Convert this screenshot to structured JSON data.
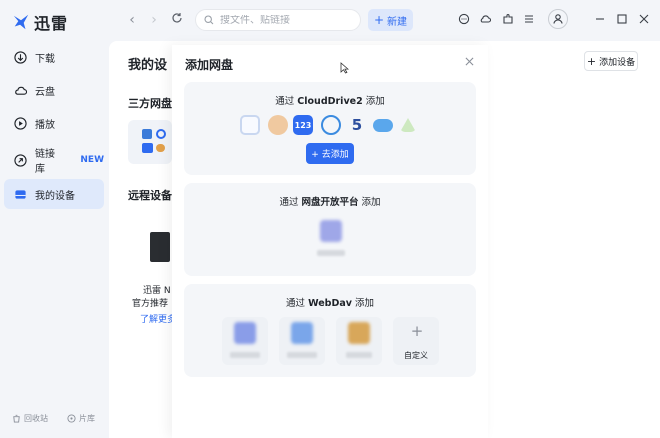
{
  "app": {
    "name": "迅雷"
  },
  "header": {
    "search_placeholder": "搜文件、贴链接",
    "new_label": "新建"
  },
  "sidebar": {
    "items": [
      {
        "label": "下载",
        "icon": "download-icon"
      },
      {
        "label": "云盘",
        "icon": "cloud-icon"
      },
      {
        "label": "播放",
        "icon": "play-icon"
      },
      {
        "label": "链接库",
        "icon": "link-icon",
        "badge": "NEW"
      },
      {
        "label": "我的设备",
        "icon": "device-icon"
      }
    ],
    "bottom": [
      {
        "label": "回收站",
        "icon": "trash-icon"
      },
      {
        "label": "片库",
        "icon": "library-icon"
      }
    ]
  },
  "main": {
    "title": "我的设",
    "add_device_label": "添加设备",
    "third_party_title": "三方网盘",
    "remote_title": "远程设备",
    "nas_line1": "迅雷 N",
    "nas_line2": "官方推荐",
    "more_link": "了解更多"
  },
  "modal": {
    "title": "添加网盘",
    "sections": [
      {
        "prefix": "通过 ",
        "name": "CloudDrive2",
        "suffix": " 添加",
        "button": "+ 去添加"
      },
      {
        "prefix": "通过 ",
        "name": "网盘开放平台",
        "suffix": " 添加"
      },
      {
        "prefix": "通过 ",
        "name": "WebDav",
        "suffix": " 添加",
        "custom_label": "自定义"
      }
    ]
  },
  "colors": {
    "accent": "#2f6bf0",
    "sidebar_active": "#dfe9fb"
  }
}
